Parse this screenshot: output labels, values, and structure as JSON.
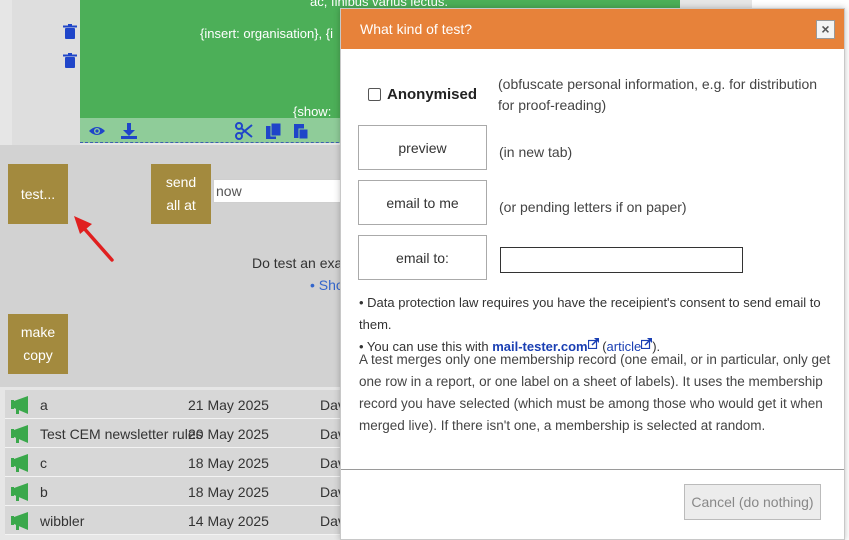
{
  "background": {
    "green_text_top": "ac, finibus varius lectus.",
    "green_text_mid": "{insert: organisation}, {i",
    "green_text_bottom": "{show:",
    "test_button": "test...",
    "send_all_button": "send all at",
    "now_input_value": "now",
    "do_test_text": "Do test an examp",
    "show_link": "• Sho",
    "make_copy_button": "make copy",
    "rows": [
      {
        "name": "a",
        "date": "21 May 2025",
        "by": "Dav"
      },
      {
        "name": "Test CEM newsletter rules",
        "date": "20 May 2025",
        "by": "Dav"
      },
      {
        "name": "c",
        "date": "18 May 2025",
        "by": "Dav"
      },
      {
        "name": "b",
        "date": "18 May 2025",
        "by": "Dav"
      },
      {
        "name": "wibbler",
        "date": "14 May 2025",
        "by": "Dav"
      }
    ]
  },
  "modal": {
    "title": "What kind of test?",
    "close_label": "×",
    "anonymised_label": "Anonymised",
    "anonymised_desc": "(obfuscate personal information, e.g. for distribution for proof-reading)",
    "preview_button": "preview",
    "preview_desc": "(in new tab)",
    "email_me_button": "email to me",
    "email_me_desc": "(or pending letters if on paper)",
    "email_to_button": "email to:",
    "email_to_value": "",
    "bullet1": "• Data protection law requires you have the receipient's consent to send email to them.",
    "bullet2_prefix": "• You can use this with ",
    "mail_tester_link": "mail-tester.com",
    "bullet2_mid": " (",
    "article_link": "article",
    "bullet2_suffix": ").",
    "paragraph": "A test merges only one membership record (one email, or in particular, only get one row in a report, or one label on a sheet of labels). It uses the membership record you have selected (which must be among those who would get it when merged live). If there isn't one, a membership is selected at random.",
    "cancel_button": "Cancel (do nothing)"
  },
  "colors": {
    "modal_header": "#e7823a",
    "olive_button": "#a38a3e",
    "green_panel": "#4caf58",
    "link_blue": "#1a3fb3",
    "annotation_arrow": "#e02020"
  }
}
